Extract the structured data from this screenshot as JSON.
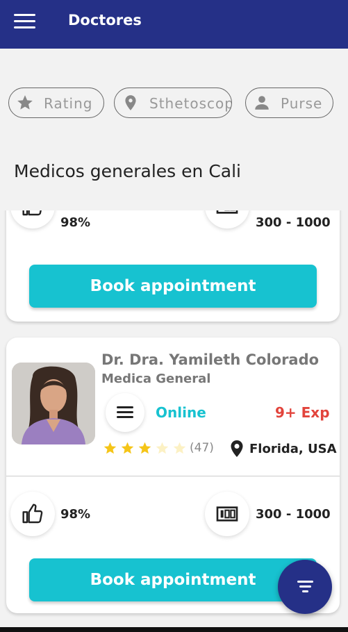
{
  "appbar": {
    "title": "Doctores",
    "menu_icon": "hamburger-menu-icon"
  },
  "filters": [
    {
      "label": "Rating",
      "icon": "star-icon"
    },
    {
      "label": "Sthetoscope",
      "icon": "location-pin-icon"
    },
    {
      "label": "Purse",
      "icon": "person-icon"
    }
  ],
  "section_title": "Medicos generales en Cali",
  "cards": [
    {
      "likes": "98%",
      "price": "300 - 1000",
      "book_label": "Book appointment"
    },
    {
      "name": "Dr. Dra. Yamileth Colorado",
      "specialty": "Medica General",
      "status": "Online",
      "experience": "9+ Exp",
      "rating": 3,
      "rating_max": 5,
      "reviews": "(47)",
      "location": "Florida, USA",
      "likes": "98%",
      "price": "300 - 1000",
      "book_label": "Book appointment"
    }
  ],
  "fab_icon": "filter-icon",
  "colors": {
    "primary": "#253087",
    "accent": "#17c2d0",
    "danger": "#e2443c",
    "star": "#f5c518"
  }
}
